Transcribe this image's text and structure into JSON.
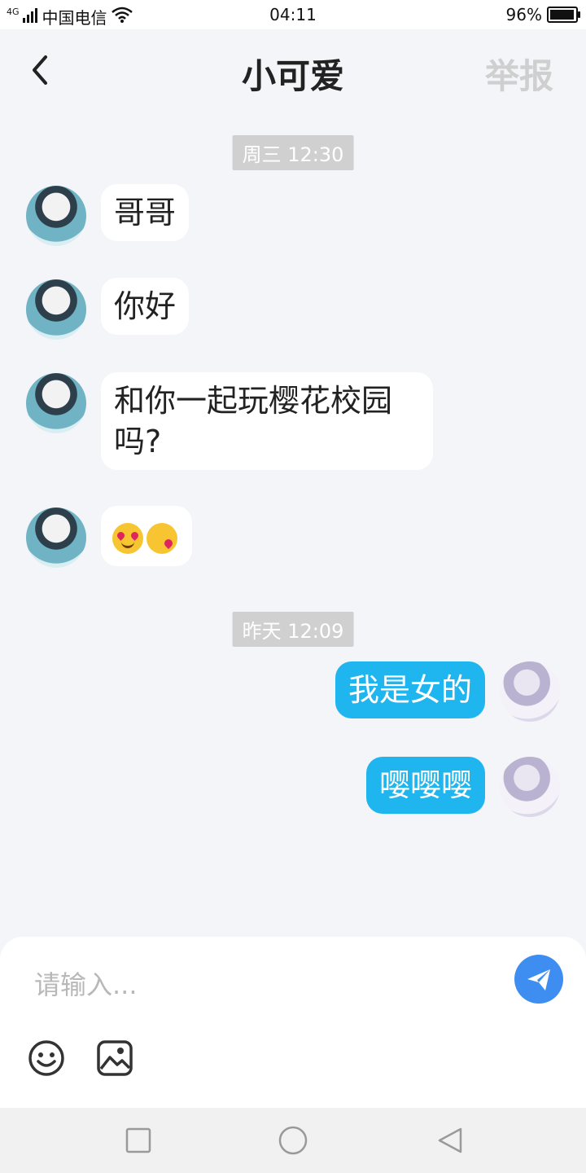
{
  "status_bar": {
    "network": "4G",
    "carrier": "中国电信",
    "time": "04:11",
    "battery": "96%",
    "battery_level": 0.96
  },
  "header": {
    "title": "小可爱",
    "report_label": "举报",
    "back_icon": "chevron-left-icon"
  },
  "messages": {
    "ts1": "周三 12:30",
    "m1": "哥哥",
    "m2": "你好",
    "m3": "和你一起玩樱花校园吗?",
    "m4_emojis": [
      "heart-eyes-emoji",
      "kiss-emoji"
    ],
    "ts2": "昨天 12:09",
    "m5": "我是女的",
    "m6": "嘤嘤嘤"
  },
  "input": {
    "placeholder": "请输入...",
    "send_icon": "paper-plane-icon",
    "emoji_icon": "smiley-icon",
    "image_icon": "image-icon"
  },
  "colors": {
    "outgoing_bubble": "#1fb6f0",
    "send_button": "#3d8ef0",
    "timestamp_bg": "#d0d0d0"
  }
}
